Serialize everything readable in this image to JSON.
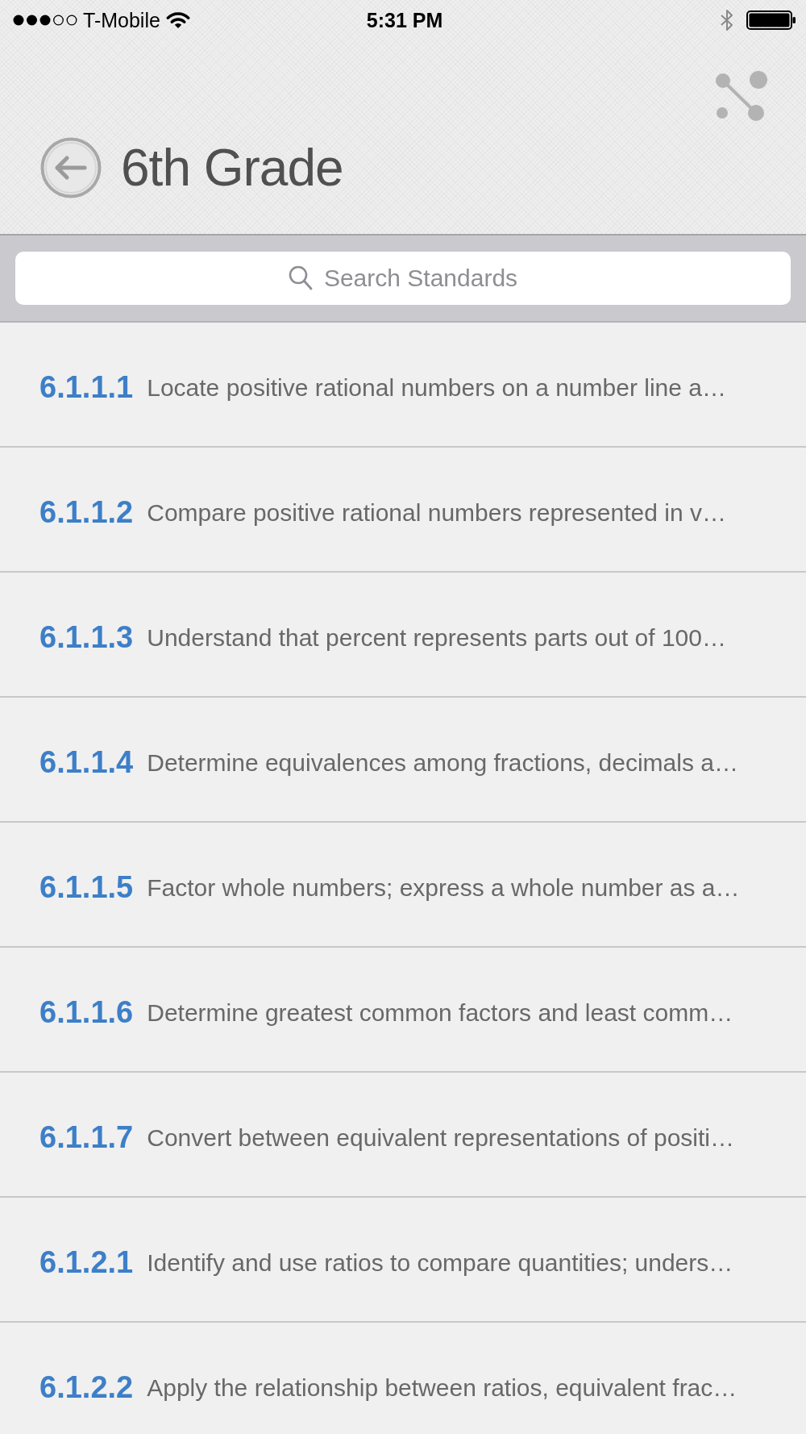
{
  "status_bar": {
    "carrier": "T-Mobile",
    "time": "5:31 PM"
  },
  "header": {
    "title": "6th Grade"
  },
  "search": {
    "placeholder": "Search Standards"
  },
  "standards": [
    {
      "code": "6.1.1.1",
      "description": "Locate positive rational numbers on a number line a…"
    },
    {
      "code": "6.1.1.2",
      "description": "Compare positive rational numbers represented in v…"
    },
    {
      "code": "6.1.1.3",
      "description": "Understand that percent represents parts out of 100…"
    },
    {
      "code": "6.1.1.4",
      "description": "Determine equivalences among fractions, decimals a…"
    },
    {
      "code": "6.1.1.5",
      "description": "Factor whole numbers; express a whole number as a…"
    },
    {
      "code": "6.1.1.6",
      "description": "Determine greatest common factors and least comm…"
    },
    {
      "code": "6.1.1.7",
      "description": "Convert between equivalent representations of positi…"
    },
    {
      "code": "6.1.2.1",
      "description": "Identify and use ratios to compare quantities; unders…"
    },
    {
      "code": "6.1.2.2",
      "description": "Apply the relationship between ratios, equivalent frac…"
    }
  ]
}
